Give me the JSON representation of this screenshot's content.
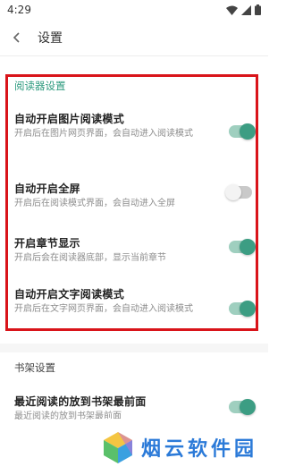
{
  "status_bar": {
    "time": "4:29"
  },
  "header": {
    "title": "设置"
  },
  "sections": [
    {
      "title": "阅读器设置",
      "items": [
        {
          "title": "自动开启图片阅读模式",
          "desc": "开启后在图片网页界面，会自动进入阅读模式",
          "enabled": true
        },
        {
          "title": "自动开启全屏",
          "desc": "开启后在阅读模式界面，会自动进入全屏",
          "enabled": false
        },
        {
          "title": "开启章节显示",
          "desc": "开启后会在阅读器底部，显示当前章节",
          "enabled": true
        },
        {
          "title": "自动开启文字阅读模式",
          "desc": "开启后在文字网页界面，会自动进入阅读模式",
          "enabled": true
        }
      ]
    },
    {
      "title": "书架设置",
      "items": [
        {
          "title": "最近阅读的放到书架最前面",
          "desc": "最近阅读的放到书架最前面",
          "enabled": true
        }
      ]
    }
  ],
  "watermark": {
    "text": "烟云软件园"
  },
  "colors": {
    "accent": "#3c9d83",
    "highlight": "#d9141a",
    "watermark": "#2b7ad8"
  }
}
